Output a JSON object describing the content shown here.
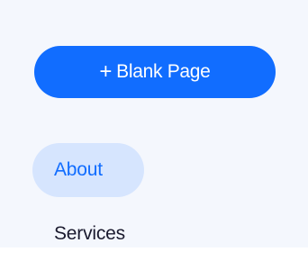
{
  "add_button": {
    "icon": "plus-icon",
    "plus_glyph": "+",
    "label": "Blank Page"
  },
  "pages": [
    {
      "label": "About",
      "selected": true
    },
    {
      "label": "Services",
      "selected": false
    }
  ],
  "colors": {
    "accent": "#116dff",
    "selected_bg": "#d6e5fe",
    "panel_bg": "#f4f7fd"
  }
}
